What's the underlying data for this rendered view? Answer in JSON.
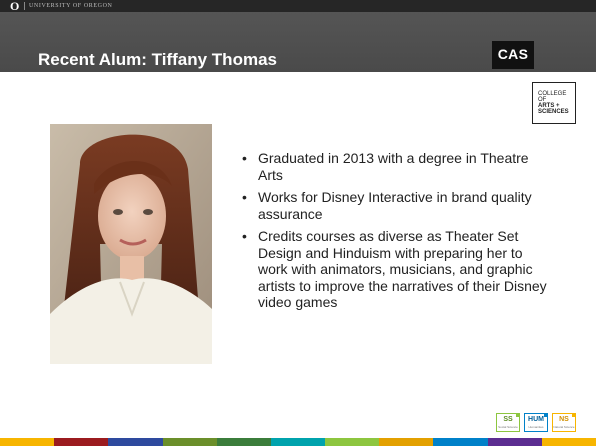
{
  "uo_bar": {
    "mark": "O",
    "name": "UNIVERSITY OF OREGON"
  },
  "slide": {
    "title": "Recent Alum: Tiffany Thomas",
    "bullets": [
      "Graduated in 2013 with a degree in Theatre Arts",
      "Works for Disney Interactive in brand quality assurance",
      "Credits courses as diverse as Theater Set Design and Hinduism with preparing her to work with animators, musicians, and graphic artists to improve the narratives of their Disney video games"
    ]
  },
  "cas": {
    "badge": "CAS",
    "card_lines": [
      "COLLEGE",
      "OF",
      "ARTS +",
      "SCIENCES"
    ]
  },
  "photo": {
    "subject": "portrait-of-tiffany-thomas"
  },
  "tags": [
    {
      "label": "SS",
      "sub": "Social Science",
      "color": "#8dc63f"
    },
    {
      "label": "HUM",
      "sub": "Humanities",
      "color": "#0081c9"
    },
    {
      "label": "NS",
      "sub": "Natural Science",
      "color": "#f7b500"
    }
  ],
  "footer_colors": [
    "#f7b500",
    "#9b1b1f",
    "#2e4a9e",
    "#6b8f2a",
    "#3b7d3b",
    "#00a3ad",
    "#8dc63f",
    "#e3a000",
    "#0081c9",
    "#5c2d91",
    "#f7b500"
  ]
}
